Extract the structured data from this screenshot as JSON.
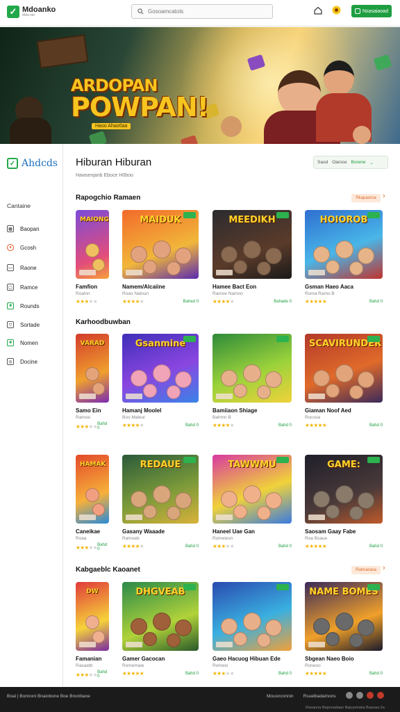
{
  "header": {
    "brand": "Mdoanko",
    "brand_sub": "Mda nto",
    "search_placeholder": "Gosoamcatols",
    "cta_label": "Nsasaiaoad",
    "colors": {
      "accent": "#1e9e41"
    }
  },
  "hero": {
    "title_line1": "ARDOPAN",
    "title_line2": "POWPAN!",
    "tagline": "Haoo Ahao0aa",
    "slides": 3
  },
  "sidebar": {
    "brand": "Ahdcds",
    "section": "Cantaine",
    "items": [
      {
        "label": "Baopan",
        "icon": "grid-icon"
      },
      {
        "label": "Gcosh",
        "icon": "fire-icon"
      },
      {
        "label": "Raone",
        "icon": "controller-icon"
      },
      {
        "label": "Ramce",
        "icon": "puzzle-icon"
      },
      {
        "label": "Rounds",
        "icon": "trophy-icon"
      },
      {
        "label": "Sortade",
        "icon": "filter-icon"
      },
      {
        "label": "Nomen",
        "icon": "gift-icon"
      },
      {
        "label": "Docine",
        "icon": "settings-icon"
      }
    ]
  },
  "main": {
    "title": "Hiburan Hiburan",
    "subtitle": "Hawsenjanb Eboce H0boo",
    "sort": {
      "label1": "Saod",
      "label2": "Oaroce",
      "selected": "Borene"
    }
  },
  "sections": [
    {
      "title": "Rapogchio Ramaen",
      "link": "Rkapaoroa",
      "cards": [
        {
          "title": "Famfion",
          "category": "Roalnn",
          "rating": 3,
          "price": "",
          "thumb_text": "MAIONG"
        },
        {
          "title": "Namem/Alcaiine",
          "category": "Roao Naloun",
          "rating": 4,
          "price": "Bahed 0",
          "thumb_text": "MAIDUK"
        },
        {
          "title": "Hamee Bact Eon",
          "category": "Ramoe Namoo",
          "rating": 4,
          "price": "Bahade 0",
          "thumb_text": "MEEDIKH"
        },
        {
          "title": "Gsman Haeo Aaca",
          "category": "Roma Ramo B",
          "rating": 5,
          "price": "Bahd 0",
          "thumb_text": "HOIOROB"
        }
      ]
    },
    {
      "title": "Karhoodbuwban",
      "link": "",
      "cards": [
        {
          "title": "Samo Ein",
          "category": "Ramoe",
          "rating": 3,
          "price": "Bahd 0",
          "thumb_text": "VARAD"
        },
        {
          "title": "Hamanj Moolel",
          "category": "Boo Maleul",
          "rating": 4,
          "price": "Bahd 0",
          "thumb_text": "Gsanmine"
        },
        {
          "title": "Bamiiaon Shiage",
          "category": "Bahmn B",
          "rating": 4,
          "price": "Bahd 0",
          "thumb_text": ""
        },
        {
          "title": "Giaman Noof Aed",
          "category": "Rocsoa",
          "rating": 5,
          "price": "Bahd 0",
          "thumb_text": "SCAVIRUNDER"
        }
      ]
    },
    {
      "title": "",
      "link": "",
      "cards": [
        {
          "title": "Caneikae",
          "category": "Roaa",
          "rating": 3,
          "price": "Bahd 0",
          "thumb_text": "HAMAK"
        },
        {
          "title": "Gasany Waaade",
          "category": "Ramoeb",
          "rating": 4,
          "price": "Bahd 0",
          "thumb_text": "REDAUE"
        },
        {
          "title": "Haneel Uae Gan",
          "category": "Romeiesn",
          "rating": 3,
          "price": "Bahd 0",
          "thumb_text": "TAWWMU"
        },
        {
          "title": "Saosam Gaay Fabe",
          "category": "Roa Bsaue",
          "rating": 5,
          "price": "Bahd 0",
          "thumb_text": "GAME:"
        }
      ]
    },
    {
      "title": "Kabgaeblc Kaoanet",
      "link": "Rahoaraoa",
      "cards": [
        {
          "title": "Famanian",
          "category": "Rasaatb",
          "rating": 3,
          "price": "Bahd 0",
          "thumb_text": "DW"
        },
        {
          "title": "Gamer Gacocan",
          "category": "Romemaie",
          "rating": 5,
          "price": "Bahd 0",
          "thumb_text": "DHGVEAB"
        },
        {
          "title": "Gaeo Hacuog Hibuan Ede",
          "category": "Romeio",
          "rating": 3,
          "price": "Bahd 0",
          "thumb_text": ""
        },
        {
          "title": "Sbgean Naeo Boio",
          "category": "Roneoo",
          "rating": 5,
          "price": "Bahd 0",
          "thumb_text": "NAME BOMES"
        }
      ]
    }
  ],
  "footer": {
    "left": "Boal  |  Bonnoni Bnaiobone Boe Bnonbane",
    "links": [
      "Mousnconnin",
      "Rsuelbadamons"
    ],
    "copyright": "Raoanna Bapeoadaan Bajoyehaba Baanaa 2a"
  }
}
